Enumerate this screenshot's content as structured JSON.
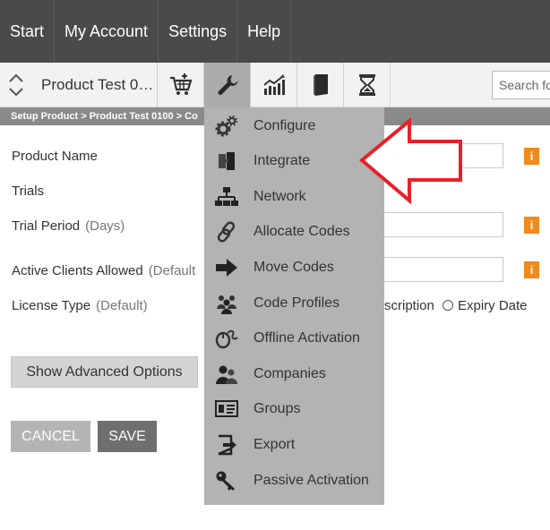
{
  "topnav": {
    "items": [
      {
        "label": "Start"
      },
      {
        "label": "My Account"
      },
      {
        "label": "Settings"
      },
      {
        "label": "Help"
      }
    ]
  },
  "toolbar": {
    "product_select": "Product Test 0…",
    "buttons": [
      {
        "icon": "cart-add-icon"
      },
      {
        "icon": "wrench-icon",
        "active": true
      },
      {
        "icon": "chart-icon"
      },
      {
        "icon": "book-icon"
      },
      {
        "icon": "hourglass-icon"
      }
    ],
    "search_placeholder": "Search fo"
  },
  "breadcrumb": "Setup Product > Product Test 0100 > Co",
  "form": {
    "product_name_label": "Product Name",
    "trials_label": "Trials",
    "trial_period_label": "Trial Period",
    "trial_period_hint": "(Days)",
    "active_clients_label": "Active Clients Allowed",
    "active_clients_hint": "(Default",
    "license_type_label": "License Type",
    "license_type_hint": "(Default)",
    "license_option_subscription": "scription",
    "license_option_expiry": "Expiry Date",
    "info_badge": "i"
  },
  "buttons": {
    "advanced": "Show Advanced Options",
    "cancel": "CANCEL",
    "save": "SAVE"
  },
  "menu": {
    "items": [
      {
        "label": "Configure",
        "icon": "gears-icon"
      },
      {
        "label": "Integrate",
        "icon": "puzzle-icon"
      },
      {
        "label": "Network",
        "icon": "network-icon"
      },
      {
        "label": "Allocate Codes",
        "icon": "link-icon"
      },
      {
        "label": "Move Codes",
        "icon": "arrow-right-icon"
      },
      {
        "label": "Code Profiles",
        "icon": "people-icon"
      },
      {
        "label": "Offline Activation",
        "icon": "mouse-icon"
      },
      {
        "label": "Companies",
        "icon": "users-icon"
      },
      {
        "label": "Groups",
        "icon": "id-card-icon"
      },
      {
        "label": "Export",
        "icon": "export-icon"
      },
      {
        "label": "Passive Activation",
        "icon": "key-icon"
      }
    ]
  },
  "colors": {
    "nav_bg": "#4a4a4a",
    "menu_bg": "#b3b3b3",
    "accent_info": "#f08a1c",
    "arrow": "#e8202a"
  }
}
